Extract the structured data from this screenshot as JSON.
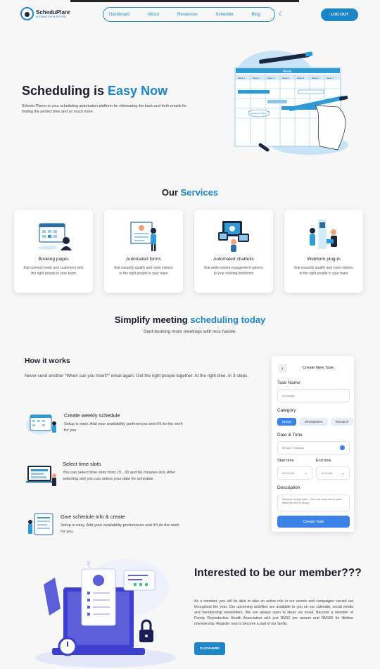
{
  "header": {
    "logo_name": "ScheduPlanr",
    "logo_tagline": "AUTOMATION PLATFORM",
    "nav": [
      "Dashboard",
      "About",
      "Resources",
      "Schedule",
      "Blog"
    ],
    "theme_icon": "moon-icon",
    "logout_label": "LOG OUT",
    "accent": "#1d86c8"
  },
  "hero": {
    "title_prefix": "Scheduling is ",
    "title_highlight": "Easy Now",
    "description": "Schedu Plannr is your scheduling automation platform for eliminating the back-and-forth emails for finding the perfect time and so much more.",
    "art": {
      "header": "Week",
      "columns": [
        "Week 1",
        "Week 2",
        "Week 3",
        "Week 4",
        "Week 5",
        "Week 6",
        "Week 7"
      ],
      "bubble": "Management Platform"
    }
  },
  "services": {
    "title_prefix": "Our ",
    "title_highlight": "Services",
    "cards": [
      {
        "name": "Booking pages",
        "desc": "that connect leads and customers with the right people in your team",
        "icon": "calendar-people-icon"
      },
      {
        "name": "Automated forms",
        "desc": "that instantly qualify and route visitors to the right people in your team",
        "icon": "form-board-icon"
      },
      {
        "name": "Automated chatbots",
        "desc": "that adds instant engagement options to your existing webforms",
        "icon": "chat-screens-icon"
      },
      {
        "name": "Webform plug-in",
        "desc": "that instantly qualify and route visitors to the right people in your team",
        "icon": "plugin-team-icon"
      }
    ]
  },
  "simplify": {
    "title_prefix": "Simplify meeting ",
    "title_highlight": "scheduling today",
    "subtitle": "Start booking more meetings with less hassle."
  },
  "how_it_works": {
    "title": "How it works",
    "description": "Never send another \"When can you meet?\" email again. Get the right people together. At the right time. In 3 steps.",
    "steps": [
      {
        "title": "Create weekly schedule",
        "desc": "Setup is easy. Add your availability preferences and it'll do the work for you."
      },
      {
        "title": "Select time slots",
        "desc": "You can select time slots from 15 , 30 and 60 minutes slot. After selecting slot you can select your date for schedule."
      },
      {
        "title": "Give schedule info & create",
        "desc": "Setup is easy. Add your availability preferences and it'll do the work for you."
      }
    ]
  },
  "task_panel": {
    "back": "‹",
    "title": "Create New Task",
    "task_name_label": "Task Name",
    "task_name_value": "UI Design",
    "category_label": "Category",
    "categories": [
      "Design",
      "Development",
      "Research"
    ],
    "active_category": "Design",
    "datetime_label": "Date & Time",
    "date_value": "08 April, Tuesday",
    "start_label": "Start time",
    "start_value": "09:00 AM",
    "end_label": "End time",
    "end_value": "11:00 AM",
    "description_label": "Description",
    "description_value": "Research design paths. There are many newer paths within the field of design...",
    "submit_label": "Create Task"
  },
  "member": {
    "title": "Interested to be our member???",
    "desc": "As a member, you will be able to take an active role in our events and campaigns carried out throughout the year. Our upcoming activities are available to you on our calendar, social media and membership newsletters. We are always open to ideas via email. Become a member of Family Reproductive Health Association with just RM12 per annum and RM100 for lifetime membership. Register now to become a part of our family.",
    "button_label": "CLICKHERE"
  }
}
